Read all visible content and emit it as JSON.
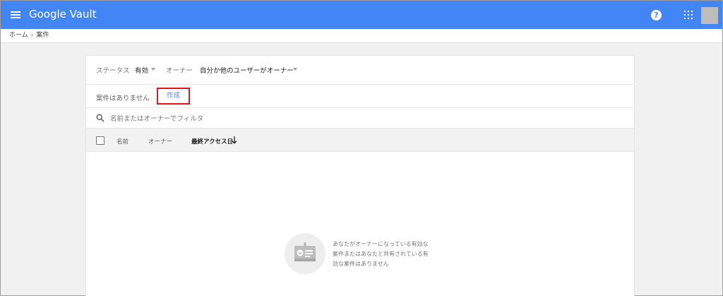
{
  "header": {
    "title": "Google Vault",
    "icons": {
      "menu": "hamburger-menu-icon",
      "help": "help-icon",
      "apps": "apps-grid-icon",
      "avatar": "account-avatar"
    },
    "help_glyph": "?",
    "color": "#4285f4"
  },
  "breadcrumb": {
    "home": "ホーム",
    "separator": "›",
    "current": "案件"
  },
  "filters": {
    "status_label": "ステータス",
    "status_value": "有効",
    "owner_label": "オーナー",
    "owner_value": "自分か他のユーザーがオーナー"
  },
  "matters": {
    "count_text": "案件はありません",
    "create_label": "作成",
    "highlight_color": "#e0141e"
  },
  "search": {
    "placeholder": "名前またはオーナーでフィルタ",
    "value": ""
  },
  "table": {
    "columns": [
      "名前",
      "オーナー",
      "最終アクセス日"
    ],
    "sort_column": "最終アクセス日",
    "sort_direction": "descending"
  },
  "empty_state": {
    "lines": [
      "あなたがオーナーになっている有効な",
      "案件またはあなたと共有されている有",
      "効な案件はありません"
    ]
  }
}
